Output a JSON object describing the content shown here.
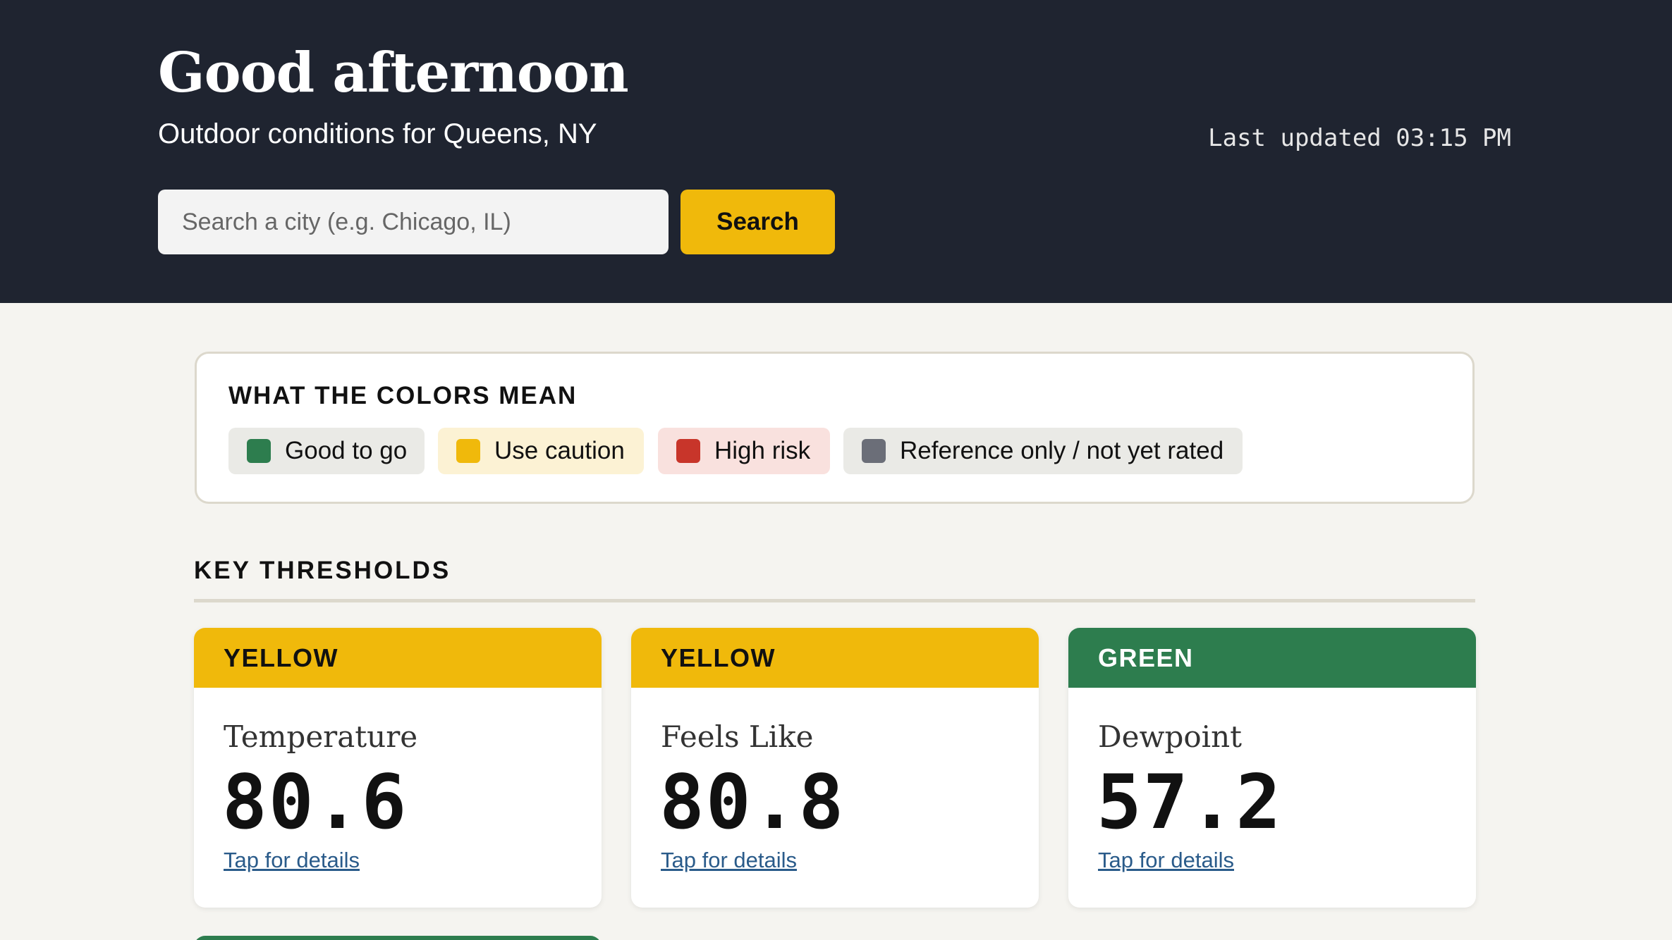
{
  "header": {
    "greeting": "Good afternoon",
    "subtitle": "Outdoor conditions for Queens, NY",
    "last_updated": "Last updated 03:15 PM",
    "search": {
      "placeholder": "Search a city (e.g. Chicago, IL)",
      "value": "",
      "button_label": "Search"
    }
  },
  "legend": {
    "title": "WHAT THE COLORS MEAN",
    "items": [
      {
        "label": "Good to go",
        "color": "#2d7d4e"
      },
      {
        "label": "Use caution",
        "color": "#f0b90b"
      },
      {
        "label": "High risk",
        "color": "#c8352a"
      },
      {
        "label": "Reference only / not yet rated",
        "color": "#6b6e78"
      }
    ]
  },
  "thresholds": {
    "title": "KEY THRESHOLDS",
    "cards": [
      {
        "status": "YELLOW",
        "status_color": "#f0b90b",
        "label": "Temperature",
        "value": "80.6",
        "link": "Tap for details"
      },
      {
        "status": "YELLOW",
        "status_color": "#f0b90b",
        "label": "Feels Like",
        "value": "80.8",
        "link": "Tap for details"
      },
      {
        "status": "GREEN",
        "status_color": "#2d7d4e",
        "label": "Dewpoint",
        "value": "57.2",
        "link": "Tap for details"
      }
    ]
  },
  "colors": {
    "header_bg": "#1f2430",
    "accent": "#f0b90b",
    "page_bg": "#f5f4f0",
    "link": "#2a5b8a"
  }
}
